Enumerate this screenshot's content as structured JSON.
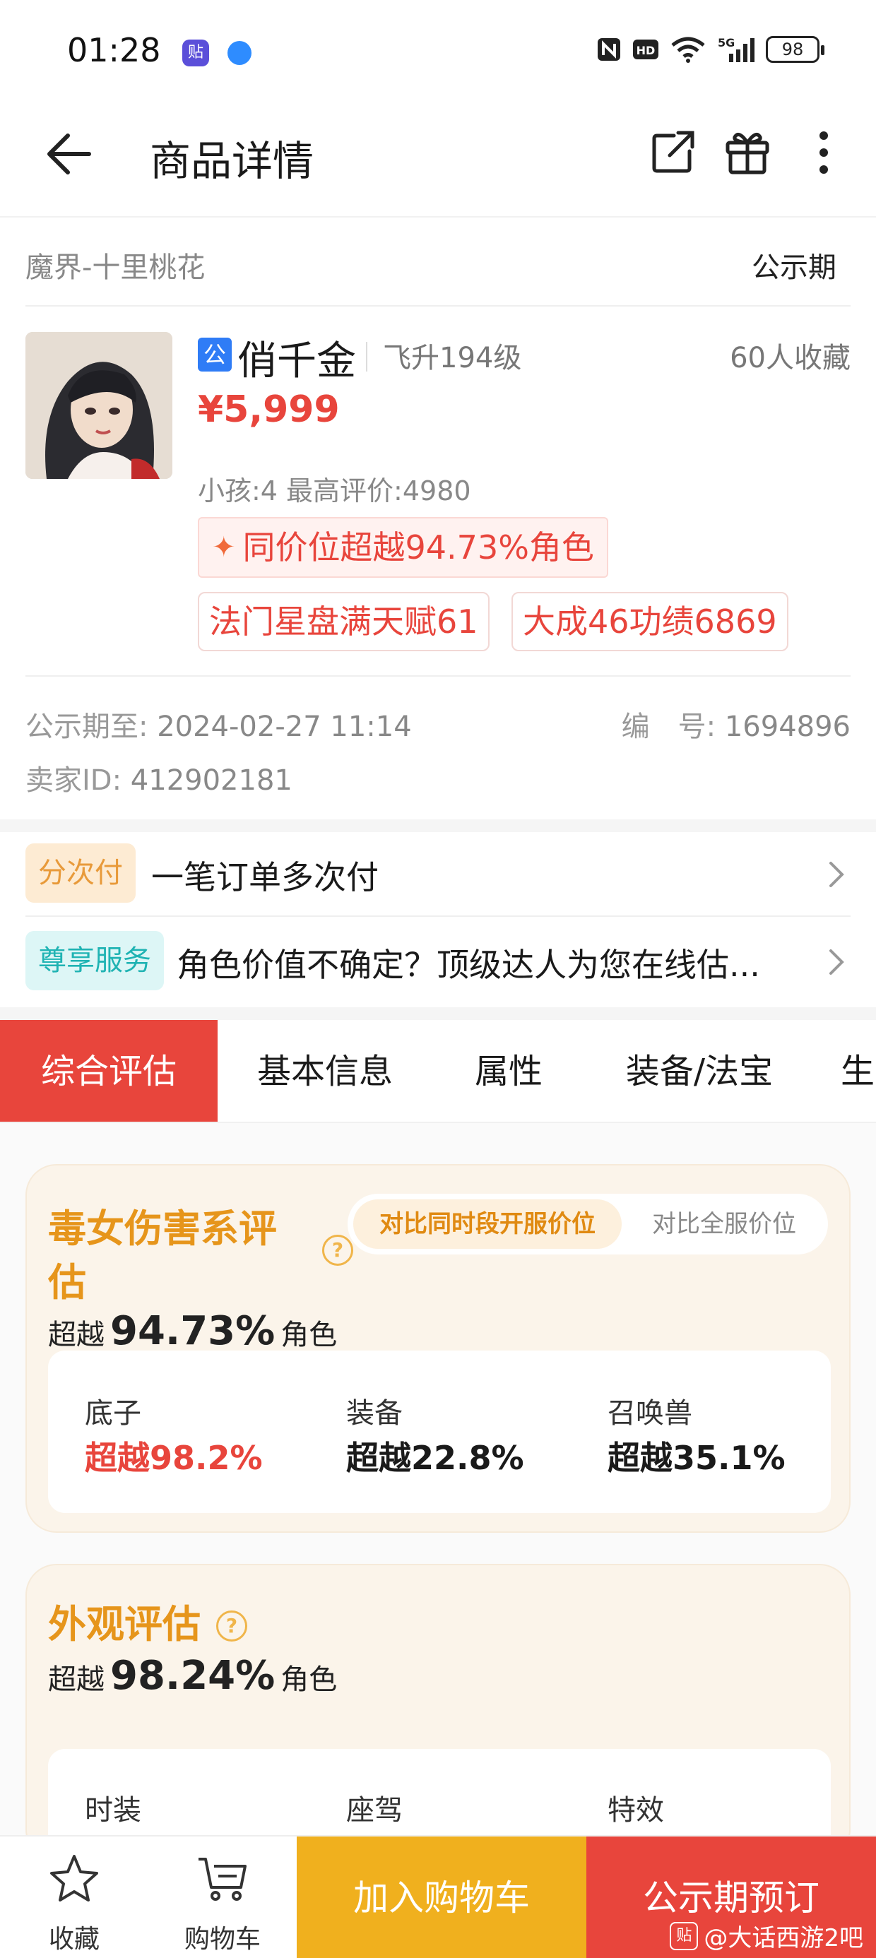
{
  "status_bar": {
    "time": "01:28",
    "app_icon_1": "贴",
    "battery": "98",
    "icons": [
      "nfc-icon",
      "hd-icon",
      "wifi-icon",
      "5g-signal-icon",
      "battery-icon"
    ]
  },
  "header": {
    "title": "商品详情",
    "back_icon": "arrow-left-icon",
    "share_icon": "share-icon",
    "gift_icon": "gift-icon",
    "more_icon": "more-vertical-icon"
  },
  "listing": {
    "server": "魔界-十里桃花",
    "status": "公示期",
    "badge": "公",
    "role_name": "俏千金",
    "level": "飞升194级",
    "favorites": "60人收藏",
    "price": "¥5,999",
    "sub_info": "小孩:4 最高评价:4980",
    "rank_tag": "同价位超越94.73%角色",
    "tags": [
      "法门星盘满天赋61",
      "大成46功绩6869"
    ],
    "publicity_label": "公示期至:",
    "publicity_date": "2024-02-27 11:14",
    "number_label": "编　号:",
    "number_value": "1694896",
    "seller_label": "卖家ID:",
    "seller_id": "412902181"
  },
  "services": [
    {
      "tag": "分次付",
      "text": "一笔订单多次付",
      "tag_bg": "#fdebd3",
      "tag_color": "#e89a3a"
    },
    {
      "tag": "尊享服务",
      "text": "角色价值不确定？顶级达人为您在线估...",
      "tag_bg": "#ddf6f6",
      "tag_color": "#1fb3b3"
    }
  ],
  "tabs": [
    "综合评估",
    "基本信息",
    "属性",
    "装备/法宝",
    "生"
  ],
  "eval_card_1": {
    "title_line1": "毒女伤害系评",
    "title_line2": "估",
    "help": "?",
    "seg_on": "对比同时段开服价位",
    "seg_off": "对比全服价位",
    "surpass_prefix": "超越",
    "surpass_value": "94.73%",
    "surpass_suffix": "角色",
    "metrics": [
      {
        "label": "底子",
        "value": "超越98.2%"
      },
      {
        "label": "装备",
        "value": "超越22.8%"
      },
      {
        "label": "召唤兽",
        "value": "超越35.1%"
      }
    ]
  },
  "eval_card_2": {
    "title": "外观评估",
    "help": "?",
    "surpass_prefix": "超越",
    "surpass_value": "98.24%",
    "surpass_suffix": "角色",
    "metrics": [
      {
        "label": "时装"
      },
      {
        "label": "座驾"
      },
      {
        "label": "特效"
      }
    ]
  },
  "bottom_bar": {
    "favorite": "收藏",
    "cart": "购物车",
    "add_to_cart": "加入购物车",
    "reserve": "公示期预订"
  },
  "watermark": {
    "logo": "贴",
    "text": "@大话西游2吧"
  },
  "colors": {
    "accent_red": "#e8453c",
    "accent_orange": "#f0b01e",
    "eval_title": "#e6951b"
  }
}
